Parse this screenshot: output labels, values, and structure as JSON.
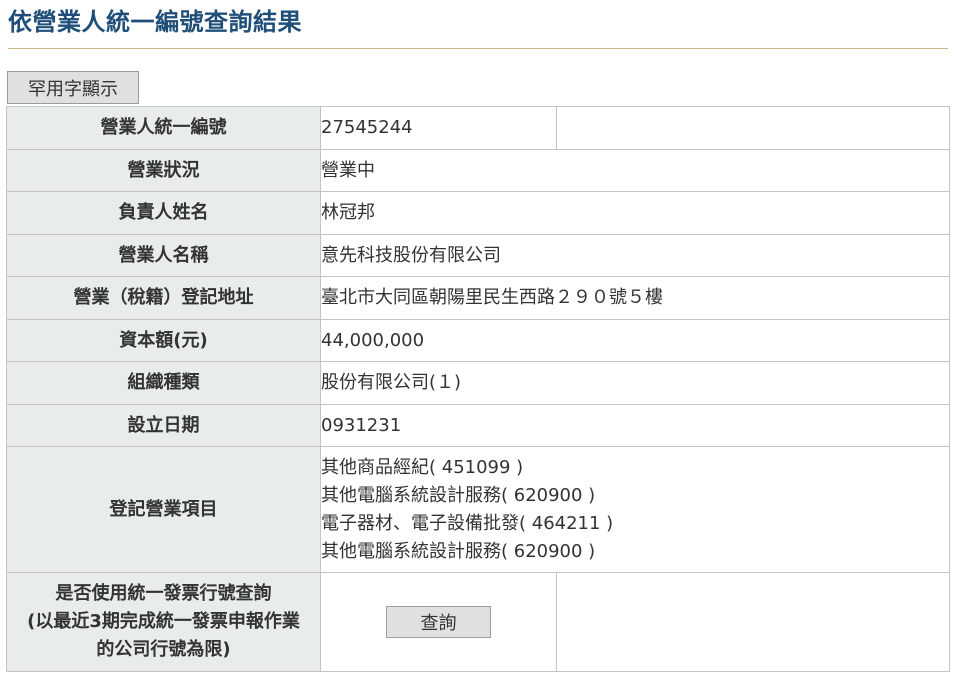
{
  "page": {
    "title": "依營業人統一編號查詢結果",
    "rare_char_button": "罕用字顯示"
  },
  "rows": {
    "tax_id": {
      "label": "營業人統一編號",
      "value": "27545244"
    },
    "status": {
      "label": "營業狀況",
      "value": "營業中",
      "value_color": "#e00000"
    },
    "owner": {
      "label": "負責人姓名",
      "value": "林冠邦"
    },
    "company_name": {
      "label": "營業人名稱",
      "value": "意先科技股份有限公司"
    },
    "address": {
      "label": "營業（稅籍）登記地址",
      "value": "臺北市大同區朝陽里民生西路２９０號５樓"
    },
    "capital": {
      "label": "資本額(元)",
      "value": "44,000,000"
    },
    "org_type": {
      "label": "組織種類",
      "value": "股份有限公司(１)"
    },
    "established": {
      "label": "設立日期",
      "value": "0931231"
    },
    "business_items": {
      "label": "登記營業項目",
      "items": [
        "其他商品經紀( 451099 )",
        "其他電腦系統設計服務( 620900 )",
        "電子器材、電子設備批發( 464211 )",
        "其他電腦系統設計服務( 620900 )"
      ]
    },
    "invoice_query": {
      "label_lines": [
        "是否使用統一發票行號查詢",
        "(以最近3期完成統一發票申報作業",
        "的公司行號為限)"
      ],
      "button_label": "查詢"
    }
  },
  "colors": {
    "title": "#1f4e79",
    "label_bg": "#e8edea",
    "status_active": "#e00000",
    "border": "#c4c4c4"
  }
}
